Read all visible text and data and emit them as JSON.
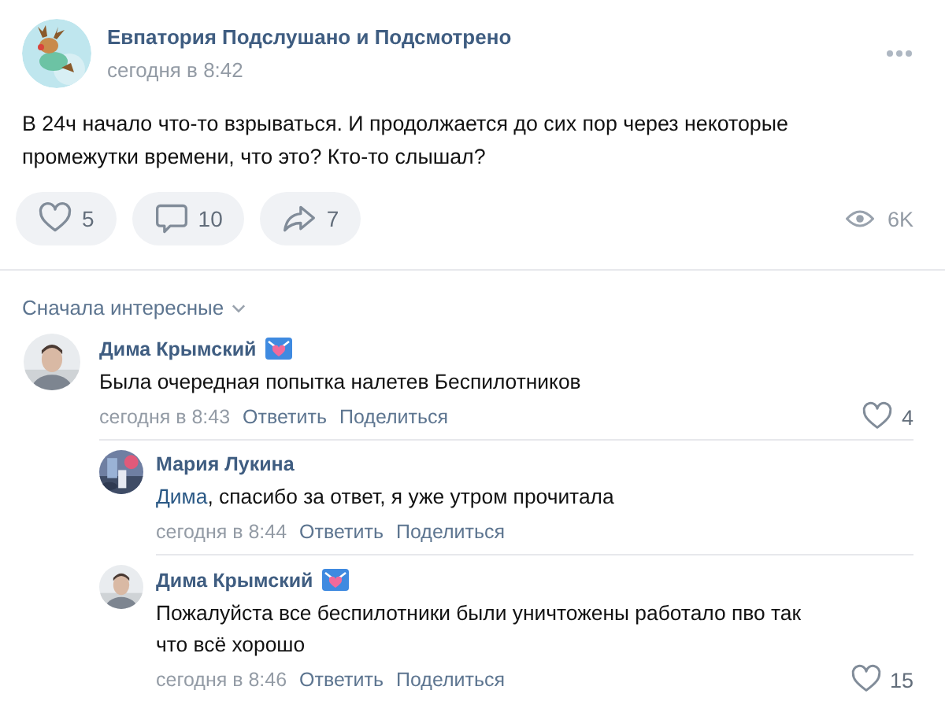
{
  "post": {
    "author": "Евпатория Подслушано и Подсмотрено",
    "time": "сегодня в 8:42",
    "text": "В 24ч начало что-то взрываться. И продолжается до сих пор через некоторые промежутки времени, что это? Кто-то слышал?",
    "actions": [
      {
        "kind": "like",
        "count": "5"
      },
      {
        "kind": "comment",
        "count": "10"
      },
      {
        "kind": "share",
        "count": "7"
      }
    ],
    "views": "6K"
  },
  "comments": {
    "sort": "Сначала интересные",
    "items": [
      {
        "author": "Дима Крымский",
        "badge": true,
        "text": "Была очередная попытка налетев Беспилотников",
        "time": "сегодня в 8:43",
        "actions": [
          "Ответить",
          "Поделиться"
        ],
        "likes": "4",
        "children": [
          {
            "author": "Мария Лукина",
            "badge": false,
            "mention": "Дима",
            "text": ", спасибо за ответ, я уже утром прочитала",
            "time": "сегодня в 8:44",
            "actions": [
              "Ответить",
              "Поделиться"
            ]
          },
          {
            "author": "Дима Крымский",
            "badge": true,
            "text": "Пожалуйста все беспилотники были уничтожены работало пво так что всё хорошо",
            "time": "сегодня в 8:46",
            "actions": [
              "Ответить",
              "Поделиться"
            ],
            "likes": "15"
          }
        ]
      }
    ]
  }
}
